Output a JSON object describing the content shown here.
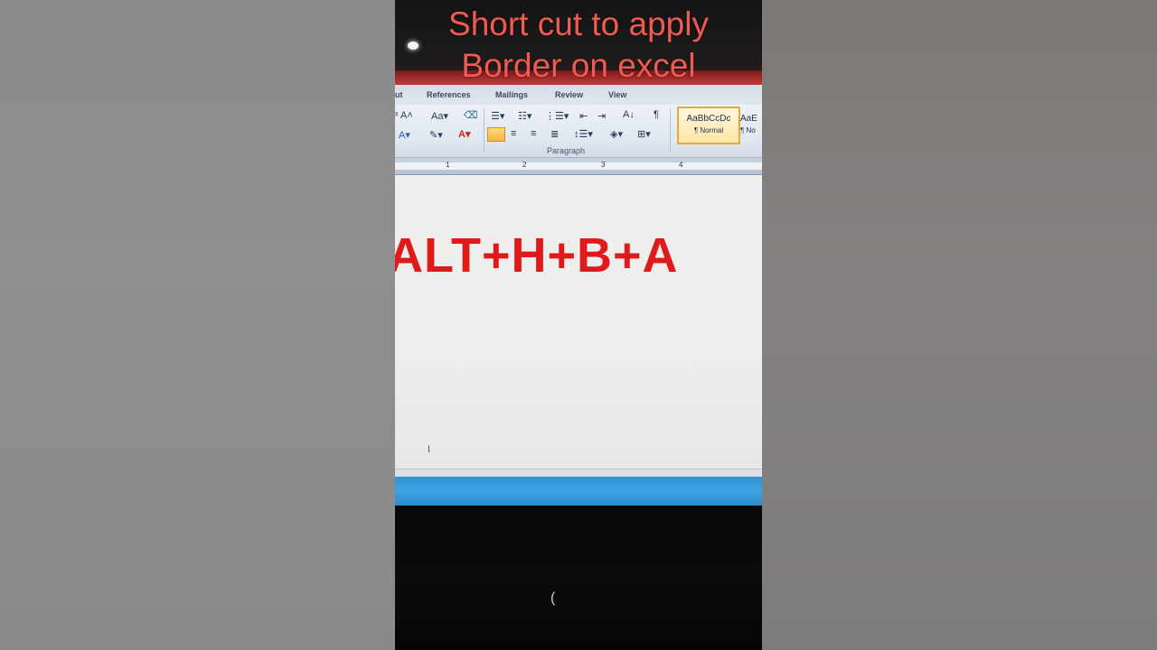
{
  "caption": {
    "line1": "Short cut to apply",
    "line2": "Border on excel"
  },
  "ribbon": {
    "tabs": [
      "ut",
      "References",
      "Mailings",
      "Review",
      "View"
    ],
    "group_label": "Paragraph",
    "styles": {
      "style1_preview": "AaBbCcDc",
      "style1_name": "¶ Normal",
      "style2_preview": "AaE",
      "style2_name": "¶ No"
    }
  },
  "ruler": {
    "numbers": [
      "1",
      "2",
      "3",
      "4"
    ]
  },
  "document": {
    "shortcut_text": "ALT+H+B+A"
  },
  "colors": {
    "caption": "#f05a50",
    "shortcut": "#e01a1a",
    "status_bar": "#3fa3e3"
  }
}
